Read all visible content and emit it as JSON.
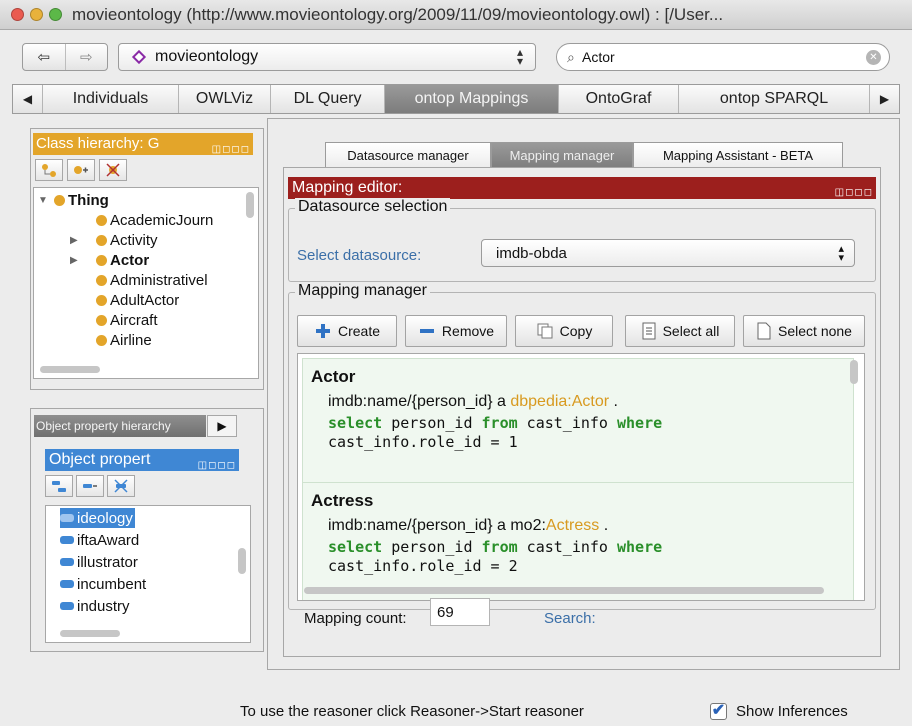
{
  "window": {
    "title": "movieontology (http://www.movieontology.org/2009/11/09/movieontology.owl) : [/User..."
  },
  "toolbar": {
    "back_icon": "⇦",
    "forward_icon": "⇨",
    "ontology": "movieontology",
    "search_value": "Actor"
  },
  "tabs": [
    "Individuals",
    "OWLViz",
    "DL Query",
    "ontop Mappings",
    "OntoGraf",
    "ontop SPARQL"
  ],
  "active_tab": "ontop Mappings",
  "class_hierarchy": {
    "title": "Class hierarchy: G",
    "items": [
      {
        "label": "Thing",
        "bold": true,
        "expand": "▼"
      },
      {
        "label": "AcademicJourn",
        "expand": ""
      },
      {
        "label": "Activity",
        "expand": "▶"
      },
      {
        "label": "Actor",
        "bold": true,
        "expand": "▶"
      },
      {
        "label": "Administrativel",
        "expand": ""
      },
      {
        "label": "AdultActor",
        "expand": ""
      },
      {
        "label": "Aircraft",
        "expand": ""
      },
      {
        "label": "Airline",
        "expand": ""
      }
    ]
  },
  "object_property": {
    "tab_label": "Object property hierarchy",
    "title": "Object propert",
    "items": [
      "ideology",
      "iftaAward",
      "illustrator",
      "incumbent",
      "industry"
    ],
    "selected": "ideology"
  },
  "sub_tabs": [
    "Datasource manager",
    "Mapping manager",
    "Mapping Assistant - BETA"
  ],
  "mapping_editor": {
    "title": "Mapping editor:",
    "datasource_legend": "Datasource selection",
    "select_label": "Select datasource:",
    "datasource": "imdb-obda",
    "manager_legend": "Mapping manager",
    "buttons": {
      "create": "Create",
      "remove": "Remove",
      "copy": "Copy",
      "select_all": "Select all",
      "select_none": "Select none"
    },
    "mappings": [
      {
        "name": "Actor",
        "target_prefix": "imdb:name/{person_id} a ",
        "target_ns": "dbpedia:",
        "target_class": "Actor",
        "sql": [
          "select",
          " person_id ",
          "from",
          " cast_info ",
          "where"
        ],
        "sql_line2": "cast_info.role_id = 1"
      },
      {
        "name": "Actress",
        "target_prefix": "imdb:name/{person_id} a ",
        "target_ns": "mo2:",
        "target_class": "Actress",
        "sql": [
          "select",
          " person_id ",
          "from",
          " cast_info ",
          "where"
        ],
        "sql_line2": "cast_info.role_id = 2"
      }
    ],
    "count_label": "Mapping count:",
    "count": "69",
    "search_label": "Search:"
  },
  "status": {
    "message": "To use the reasoner click Reasoner->Start reasoner",
    "show_inferences": "Show Inferences",
    "checked": true
  }
}
